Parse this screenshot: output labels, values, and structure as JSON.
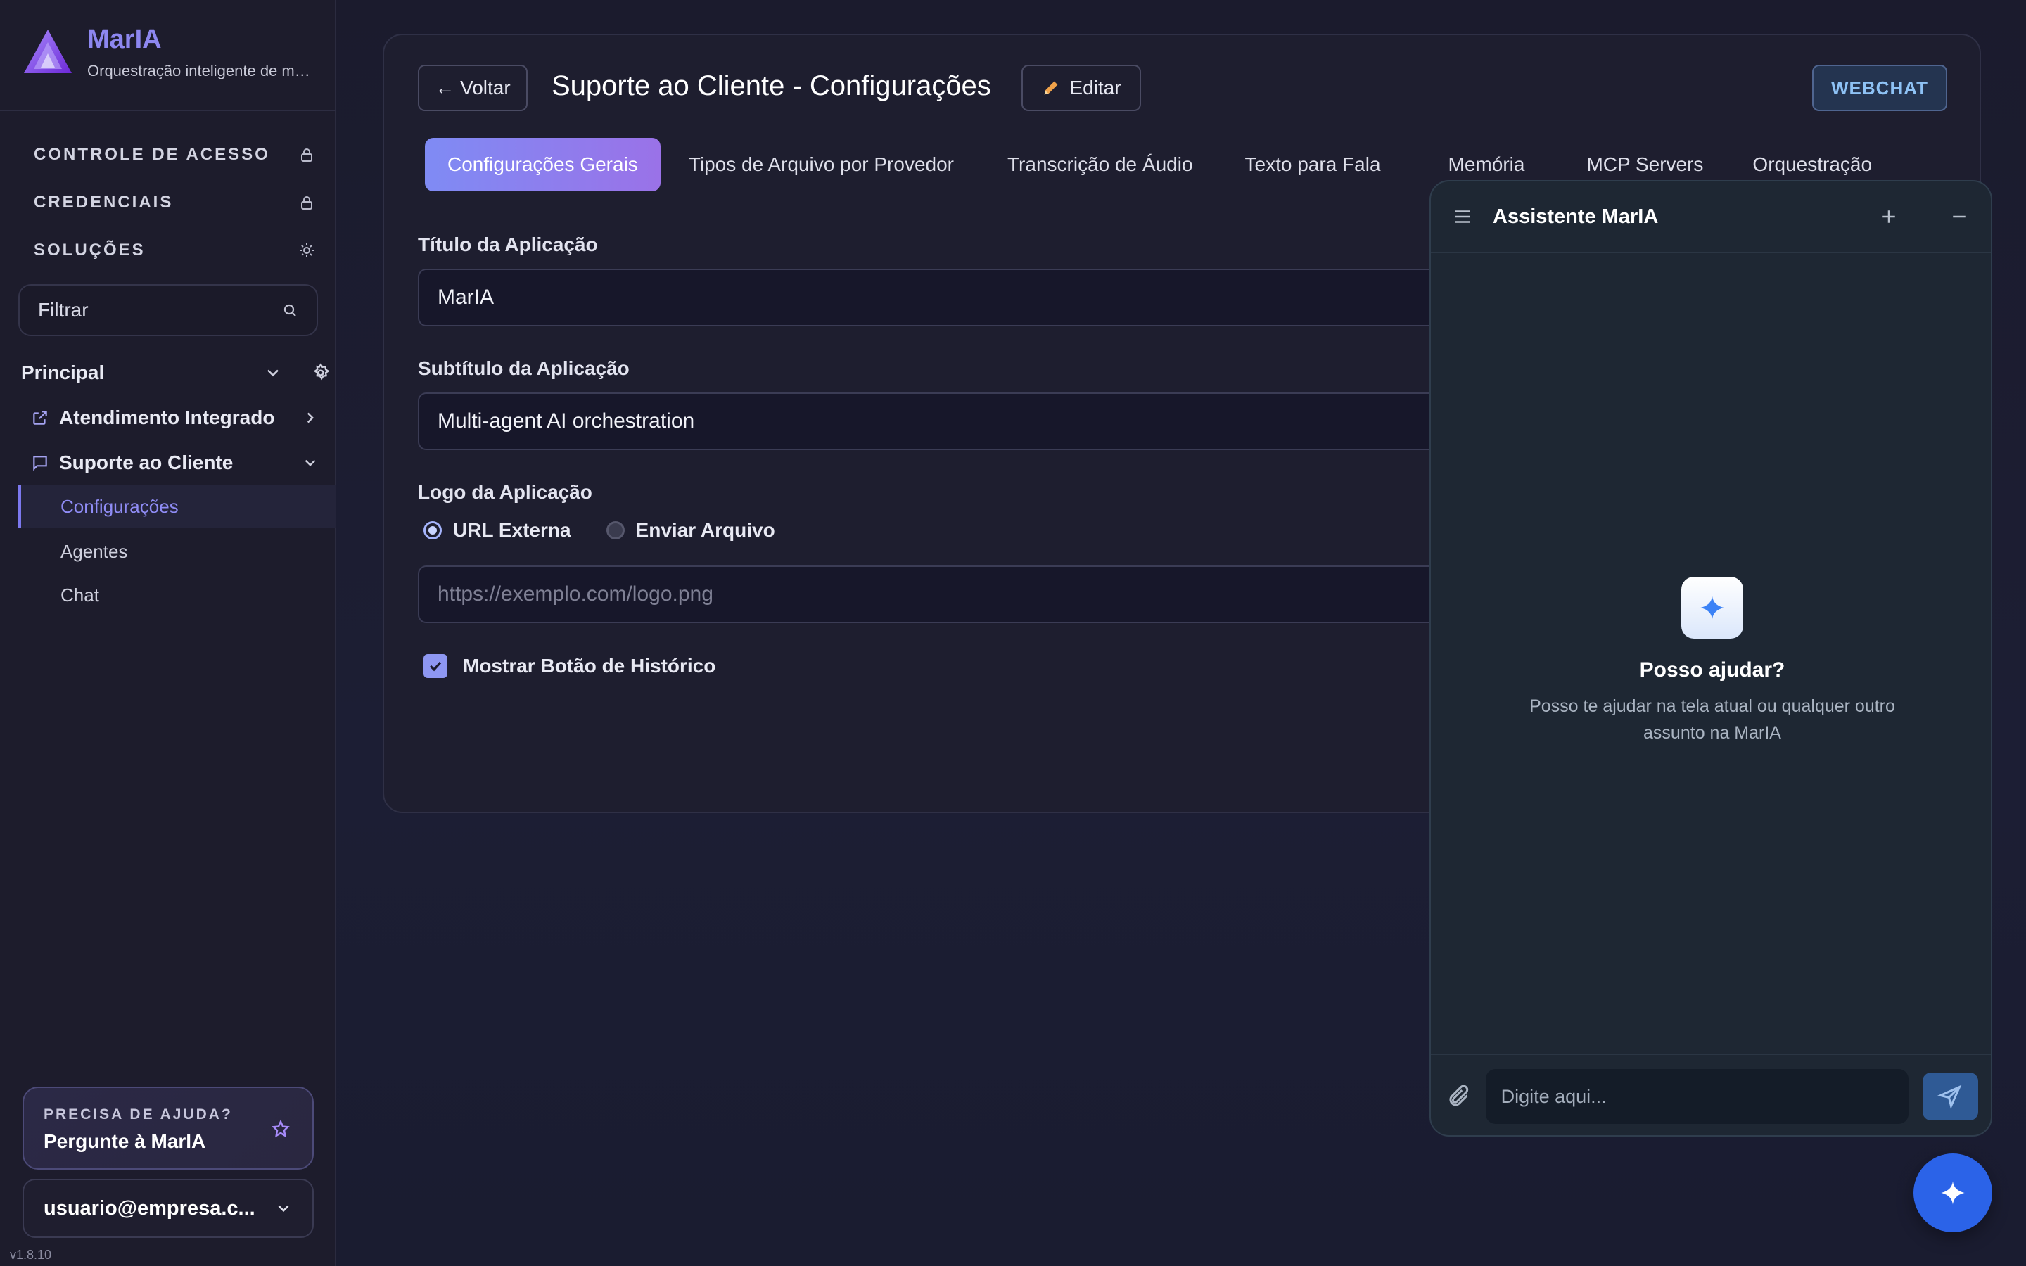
{
  "brand": {
    "title": "MarIA",
    "subtitle": "Orquestração inteligente de múltiplos agentes"
  },
  "sidebar": {
    "sections": [
      {
        "label": "CONTROLE DE ACESSO",
        "icon": "lock-icon"
      },
      {
        "label": "CREDENCIAIS",
        "icon": "lock-icon"
      },
      {
        "label": "SOLUÇÕES",
        "icon": "sun-icon"
      }
    ],
    "filter_placeholder": "Filtrar",
    "group": {
      "label": "Principal"
    },
    "items": [
      {
        "label": "Atendimento Integrado",
        "icon": "external-link-icon"
      },
      {
        "label": "Suporte ao Cliente",
        "icon": "chat-bubble-icon"
      }
    ],
    "sub_items": [
      "Configurações",
      "Agentes",
      "Chat"
    ],
    "active_sub": "Configurações",
    "help": {
      "kicker": "PRECISA DE AJUDA?",
      "title": "Pergunte à MarIA"
    },
    "user": "usuario@empresa.c...",
    "version": "v1.8.10"
  },
  "header": {
    "back_label": "← Voltar",
    "title": "Suporte ao Cliente - Configurações",
    "edit_label": "Editar",
    "webchat_label": "WEBCHAT"
  },
  "tabs": [
    {
      "label": "Configurações Gerais",
      "active": true
    },
    {
      "label": "Tipos de Arquivo por Provedor"
    },
    {
      "label": "Transcrição de Áudio"
    },
    {
      "label": "Texto para Fala"
    },
    {
      "label": "Memória"
    },
    {
      "label": "MCP Servers"
    },
    {
      "label": "Orquestração"
    }
  ],
  "form": {
    "app_title_label": "Título da Aplicação",
    "app_title_value": "MarIA",
    "app_subtitle_label": "Subtítulo da Aplicação",
    "app_subtitle_value": "Multi-agent AI orchestration",
    "logo_label": "Logo da Aplicação",
    "logo_options": [
      "URL Externa",
      "Enviar Arquivo"
    ],
    "logo_selected": "URL Externa",
    "logo_url_placeholder": "https://exemplo.com/logo.png",
    "history_label": "Mostrar Botão de Histórico",
    "history_checked": true
  },
  "chat": {
    "title": "Assistente MarIA",
    "empty_title": "Posso ajudar?",
    "empty_desc": "Posso te ajudar na tela atual ou qualquer outro assunto na MarIA",
    "input_placeholder": "Digite aqui..."
  },
  "colors": {
    "accent": "#8d87f0",
    "tab_active_start": "#7f8bf4",
    "tab_active_end": "#9a72e8",
    "fab": "#2b63e8"
  }
}
